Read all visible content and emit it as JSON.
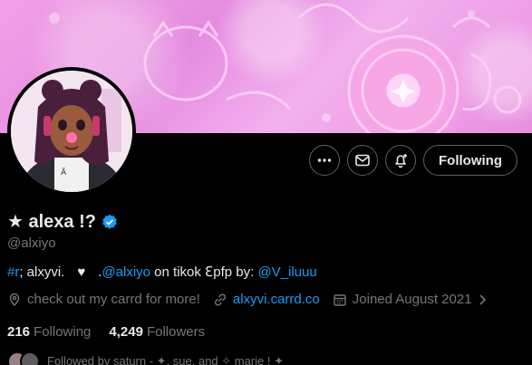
{
  "profile": {
    "name": "★ alexa !?",
    "handle": "@alxiyo",
    "bio": {
      "tag": "#r",
      "text1": "; alxyvi.",
      "heart": "♥",
      "dot": ".",
      "mention1": "@alxiyo",
      "text2": " on tikok ",
      "symbol": "ℇ",
      "text3": "pfp by: ",
      "mention2": "@V_iluuu"
    },
    "location": "check out my carrd for more!",
    "website": "alxyvi.carrd.co",
    "joined": "Joined August 2021"
  },
  "stats": {
    "following_count": "216",
    "following_label": "Following",
    "followers_count": "4,249",
    "followers_label": "Followers"
  },
  "followed_by": "Followed by saturn - ✦, sue, and ✧ marie ! ✦",
  "actions": {
    "follow_label": "Following",
    "more_icon": "more-icon",
    "message_icon": "envelope-icon",
    "notify_icon": "bell-plus-icon"
  },
  "colors": {
    "accent": "#1d9bf0",
    "muted": "#71767b",
    "text": "#e7e9ea",
    "banner": "#e88fdf"
  }
}
